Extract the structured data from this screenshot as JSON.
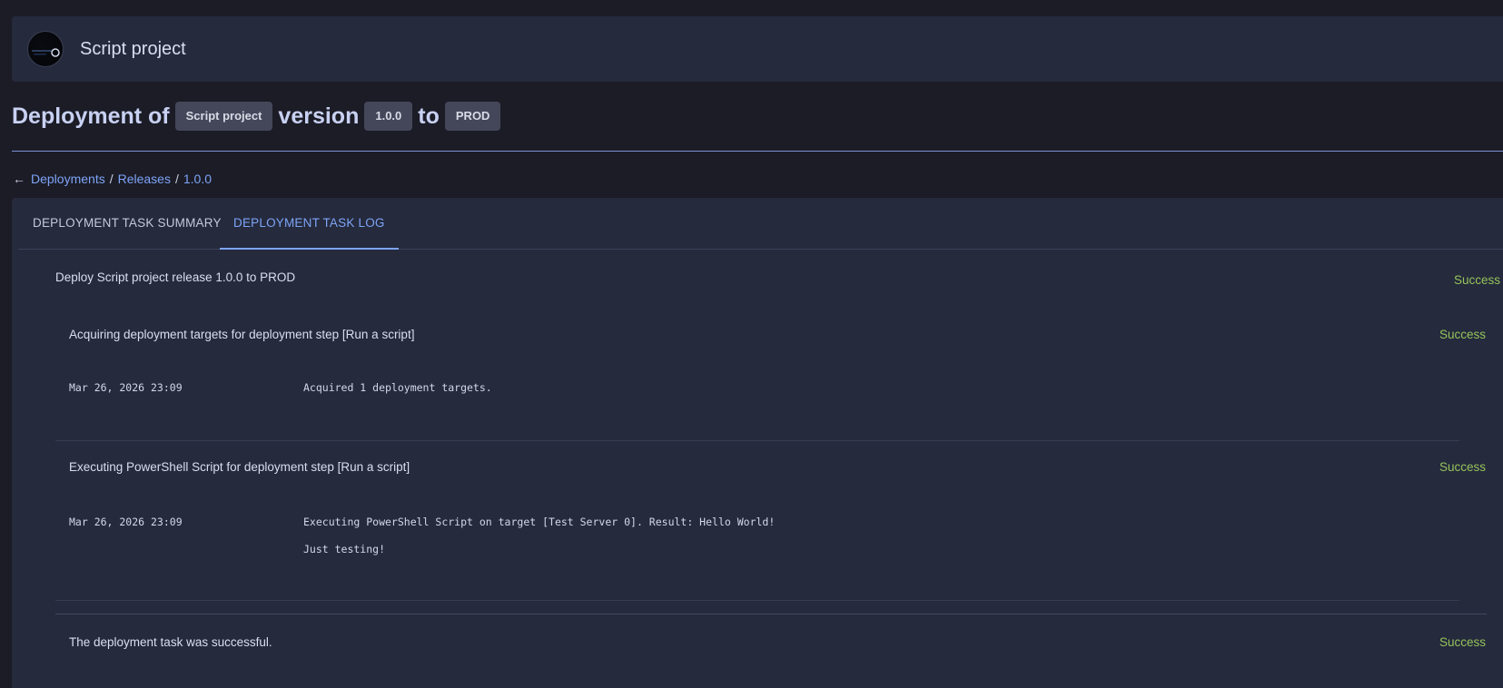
{
  "header": {
    "project_name": "Script project"
  },
  "title": {
    "deployment_of": "Deployment of",
    "project_chip": "Script project",
    "version_word": "version",
    "version_chip": "1.0.0",
    "to_word": "to",
    "env_chip": "PROD"
  },
  "breadcrumb": {
    "back_arrow": "←",
    "items": [
      "Deployments",
      "Releases",
      "1.0.0"
    ],
    "separator": "/"
  },
  "tabs": [
    {
      "label": "DEPLOYMENT TASK SUMMARY",
      "active": false
    },
    {
      "label": "DEPLOYMENT TASK LOG",
      "active": true
    }
  ],
  "log": {
    "root": {
      "text": "Deploy Script project release 1.0.0 to PROD",
      "status": "Success"
    },
    "steps": [
      {
        "text": "Acquiring deployment targets for deployment step [Run a script]",
        "status": "Success",
        "entries": [
          {
            "time": "Mar 26, 2026 23:09",
            "lines": [
              "Acquired 1 deployment targets."
            ]
          }
        ]
      },
      {
        "text": "Executing PowerShell Script for deployment step [Run a script]",
        "status": "Success",
        "entries": [
          {
            "time": "Mar 26, 2026 23:09",
            "lines": [
              "Executing PowerShell Script on target [Test Server 0]. Result: Hello World!",
              "Just testing!"
            ]
          }
        ]
      }
    ],
    "final": {
      "text": "The deployment task was successful.",
      "status": "Success"
    }
  },
  "colors": {
    "background": "#1b1c26",
    "panel": "#252a3d",
    "accent": "#7ea4f6",
    "success": "#95c35a"
  }
}
